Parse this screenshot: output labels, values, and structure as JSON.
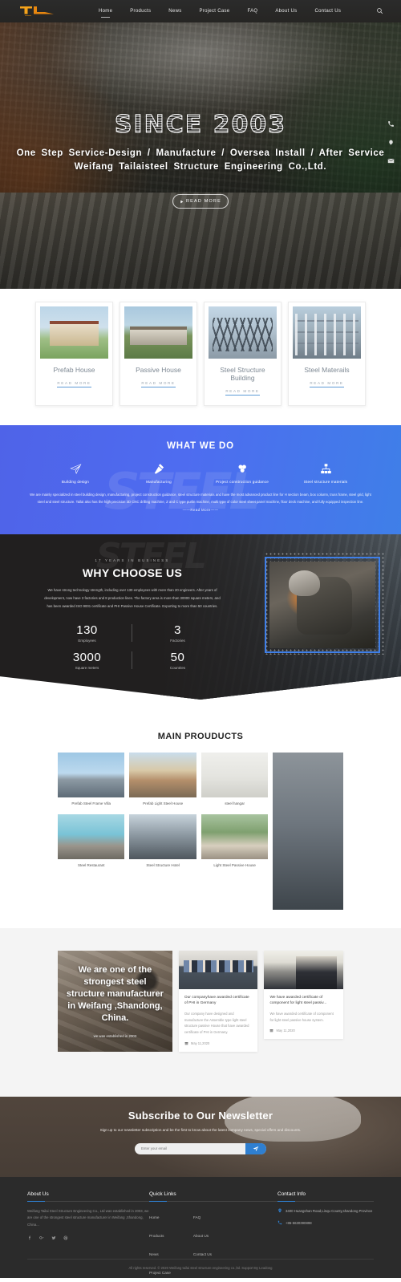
{
  "header": {
    "logo_alt": "TL Tailaisteel logo",
    "nav": [
      {
        "label": "Home",
        "active": true
      },
      {
        "label": "Products",
        "active": false
      },
      {
        "label": "News",
        "active": false
      },
      {
        "label": "Project Case",
        "active": false
      },
      {
        "label": "FAQ",
        "active": false
      },
      {
        "label": "About Us",
        "active": false
      },
      {
        "label": "Contact Us",
        "active": false
      }
    ],
    "search_icon": "search-icon"
  },
  "hero": {
    "since": "SINCE 2003",
    "line1": "One  Step  Service-Design  /  Manufacture  /  Oversea  Install  /  After  Service",
    "line2": "Weifang  Tailaisteel  Structure  Engineering  Co.,Ltd.",
    "button": "READ MORE"
  },
  "side_icons": [
    {
      "name": "phone-icon"
    },
    {
      "name": "wechat-icon"
    },
    {
      "name": "email-icon"
    }
  ],
  "cards": [
    {
      "title": "Prefab House",
      "more": "READ MORE",
      "img": "prefab-house-thumb"
    },
    {
      "title": "Passive House",
      "more": "READ MORE",
      "img": "passive-house-thumb"
    },
    {
      "title": "Steel Structure Building",
      "more": "READ MORE",
      "img": "steel-structure-building-thumb"
    },
    {
      "title": "Steel Materails",
      "more": "READ MORE",
      "img": "steel-materials-thumb"
    }
  ],
  "what_we_do": {
    "watermark": "STEEL",
    "title": "WHAT WE DO",
    "items": [
      {
        "label": "Building design",
        "icon": "paper-plane-icon"
      },
      {
        "label": "Manufacturing",
        "icon": "hammer-icon"
      },
      {
        "label": "Project construction guidance",
        "icon": "molecule-icon"
      },
      {
        "label": "Steel structure materials",
        "icon": "sitemap-icon"
      }
    ],
    "paragraph": "We are mainly specialized in steel building design, manufacturing, project construction guidance, steel structure materials and have the most advanced product line for H section beam, box column, truss frame, steel grid, light steel and steel structure. Tailai also has the high precision 3D CNC drilling machine, Z and C type purlin machine, multi type of color steel sheet panel machine, floor deck machine, and fully equipped inspection line.",
    "more": "——Read  More——"
  },
  "why_choose_us": {
    "kicker": "17 YEARS IN BUSINESS",
    "title": "WHY CHOOSE US",
    "paragraph": "We have   strong technology strength, including over 130 employees with more than 20 engineers. After years of development, now have 3 factories and 8 production lines. The factory area is more than 30000 square meters, and has been awarded ISO 9001 certificate and PHI Passive House Certificate. Exporting to more than 50 countries.",
    "stats": [
      {
        "num": "130",
        "label": "Employees"
      },
      {
        "num": "3",
        "label": "Factories"
      },
      {
        "num": "3000",
        "label": "Square meters"
      },
      {
        "num": "50",
        "label": "Countries"
      }
    ],
    "photo_alt": "welder-photo"
  },
  "main_products": {
    "title": "MAIN PROUDUCTS",
    "col1": [
      {
        "caption": "Prefab Steel Frame Villa",
        "img": "prefab-steel-frame-villa"
      },
      {
        "caption": "Steel Restaurant",
        "img": "steel-restaurant"
      }
    ],
    "col2": [
      {
        "caption": "Prefab Light Steel House",
        "img": "prefab-light-steel-house"
      },
      {
        "caption": "Steel Structure Hotel",
        "img": "steel-structure-hotel"
      }
    ],
    "col3": [
      {
        "caption": "steel hangar",
        "img": "steel-hangar"
      },
      {
        "caption": "Light Steel Passive House",
        "img": "light-steel-passive-house"
      }
    ],
    "col4": [
      {
        "caption": "",
        "img": "steel-parking-structure"
      }
    ]
  },
  "news": {
    "hero": {
      "title": "We are one of the strongest steel structure  manufacturer in Weifang ,Shandong, China.",
      "sub": "we was established in 2003",
      "img": "desk-office-photo"
    },
    "items": [
      {
        "img": "team-certificate-photo",
        "title": "Our companyhave awarded certificate of PHI in Germany",
        "excerpt": "Our company have designed and manufacture the Assemble type light steel structure passive House that have awarded certificate of PHI in Germany.",
        "date": "May 11,2020",
        "date_icon": "calendar-icon"
      },
      {
        "img": "award-ceremony-photo",
        "title": "We have awarded certificate of component for light steel passiv...",
        "excerpt": "We have awarded certificate of component for light steel passive house system.",
        "date": "May 11,2020",
        "date_icon": "calendar-icon"
      }
    ]
  },
  "newsletter": {
    "title": "Subscribe to Our Newsletter",
    "subtitle": "Sign up to our newsletter subscription and be the first to know about the latest company news, special offers and discounts.",
    "placeholder": "Enter your email",
    "value": "",
    "submit_icon": "send-icon",
    "accent": "#2f7fd0"
  },
  "footer": {
    "about": {
      "heading": "About Us",
      "text": "Weifang Tailai Steel Structure Engineering Co., Ltd was established in 2003, we are one of the strongest steel structure  manufacturer in Weifang ,Shandong, China...",
      "social": [
        "facebook-icon",
        "google-plus-icon",
        "twitter-icon",
        "pinterest-icon"
      ]
    },
    "quick_links": {
      "heading": "Quick Links",
      "col1": [
        "Home",
        "Products",
        "News",
        "Project Case"
      ],
      "col2": [
        "FAQ",
        "About Us",
        "Contact Us"
      ]
    },
    "contact": {
      "heading": "Contact Info",
      "address": "3400 Huangshan Road,Linqu County,shandong Province",
      "address_icon": "location-icon",
      "phone": "+86-5630390898",
      "phone_icon": "phone-icon"
    },
    "copyright": "All rights reserved. © 2020 Weifang tailai steel structure engineering co.,ltd.  Support By Leadong"
  }
}
